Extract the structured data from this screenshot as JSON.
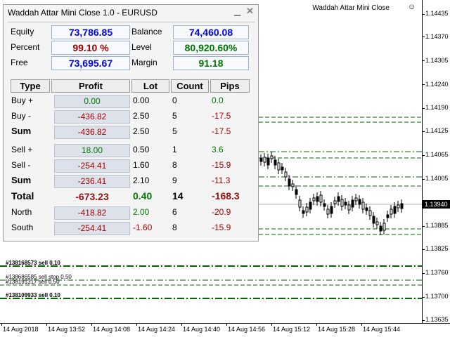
{
  "chart": {
    "indicator_name": "Waddah Attar Mini Close",
    "price_labels": [
      "1.14435",
      "1.14370",
      "1.14305",
      "1.14240",
      "1.14190",
      "1.14125",
      "1.14065",
      "1.14005",
      "1.13940",
      "1.13885",
      "1.13825",
      "1.13760",
      "1.13700",
      "1.13635"
    ],
    "current_price": "1.13940",
    "time_labels": [
      "14 Aug 2018",
      "14 Aug 13:52",
      "14 Aug 14:08",
      "14 Aug 14:24",
      "14 Aug 14:40",
      "14 Aug 14:56",
      "14 Aug 15:12",
      "14 Aug 15:28",
      "14 Aug 15:44"
    ],
    "order_labels": [
      "#138168573 sell 0.10",
      "#138686585 sell stop 0.50",
      "#138191317 sell 0.50",
      "#138109933 sell 0.10"
    ],
    "colors": {
      "order_line": "#006400",
      "candle": "#000000"
    }
  },
  "panel": {
    "title": "Waddah Attar Mini Close 1.0  - EURUSD",
    "summary": {
      "equity_label": "Equity",
      "equity_value": "73,786.85",
      "balance_label": "Balance",
      "balance_value": "74,460.08",
      "percent_label": "Percent",
      "percent_value": "99.10 %",
      "level_label": "Level",
      "level_value": "80,920.60%",
      "free_label": "Free",
      "free_value": "73,695.67",
      "margin_label": "Margin",
      "margin_value": "91.18"
    },
    "headers": {
      "type": "Type",
      "profit": "Profit",
      "lot": "Lot",
      "count": "Count",
      "pips": "Pips"
    },
    "rows": [
      {
        "type": "Buy +",
        "profit": "0.00",
        "lot": "0.00",
        "count": "0",
        "pips": "0.0"
      },
      {
        "type": "Buy -",
        "profit": "-436.82",
        "lot": "2.50",
        "count": "5",
        "pips": "-17.5"
      },
      {
        "type": "Sum",
        "profit": "-436.82",
        "lot": "2.50",
        "count": "5",
        "pips": "-17.5"
      },
      {
        "type": "Sell +",
        "profit": "18.00",
        "lot": "0.50",
        "count": "1",
        "pips": "3.6"
      },
      {
        "type": "Sell -",
        "profit": "-254.41",
        "lot": "1.60",
        "count": "8",
        "pips": "-15.9"
      },
      {
        "type": "Sum",
        "profit": "-236.41",
        "lot": "2.10",
        "count": "9",
        "pips": "-11.3"
      },
      {
        "type": "Total",
        "profit": "-673.23",
        "lot": "0.40",
        "count": "14",
        "pips": "-168.3"
      },
      {
        "type": "North",
        "profit": "-418.82",
        "lot": "2.00",
        "count": "6",
        "pips": "-20.9"
      },
      {
        "type": "South",
        "profit": "-254.41",
        "lot": "-1.60",
        "count": "8",
        "pips": "-15.9"
      }
    ]
  }
}
